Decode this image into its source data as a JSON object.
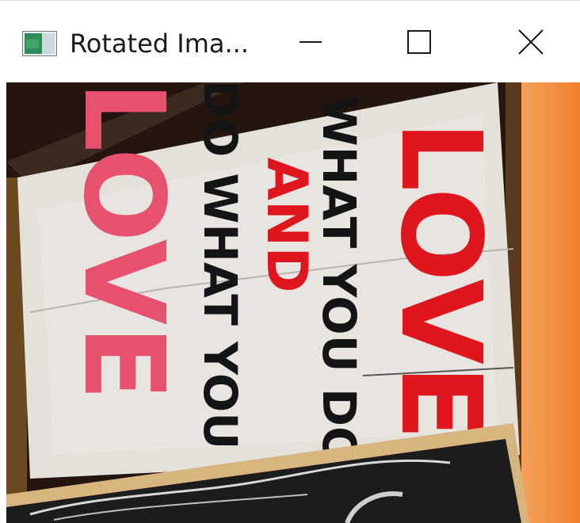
{
  "window": {
    "title": "Rotated Ima...",
    "icon": "image-app-icon",
    "controls": {
      "minimize": "minimize-icon",
      "maximize": "maximize-icon",
      "close": "close-icon"
    }
  },
  "image": {
    "line1": "LOVE",
    "line2": "WHAT YOU DO",
    "line3": "AND",
    "line4": "DO WHAT YOU",
    "line5": "LOVE",
    "colors": {
      "red": "#e0161f",
      "pink": "#e85070",
      "black": "#141414",
      "board": "#e6e3dd",
      "fabric": "#f08a3c"
    }
  }
}
